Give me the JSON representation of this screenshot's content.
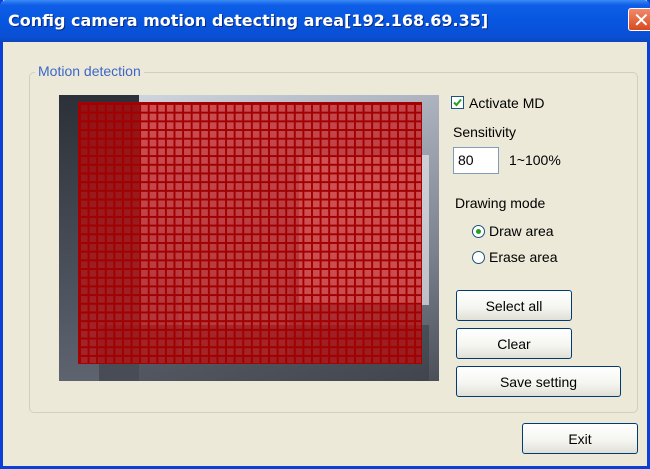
{
  "window": {
    "title": "Config camera motion detecting area[192.168.69.35]",
    "close_glyph": "✕"
  },
  "group": {
    "label": "Motion detection"
  },
  "activate": {
    "label": "Activate MD",
    "checked": true
  },
  "sensitivity": {
    "label": "Sensitivity",
    "value": "80",
    "range": "1~100%"
  },
  "drawing_mode": {
    "label": "Drawing mode",
    "options": [
      "Draw area",
      "Erase area"
    ],
    "selected": "Draw area"
  },
  "buttons": {
    "select_all": "Select all",
    "clear": "Clear",
    "save": "Save setting",
    "exit": "Exit"
  },
  "colors": {
    "title_bar": "#0756e0",
    "grid": "#d20000",
    "dialog_bg": "#ece9d8"
  }
}
